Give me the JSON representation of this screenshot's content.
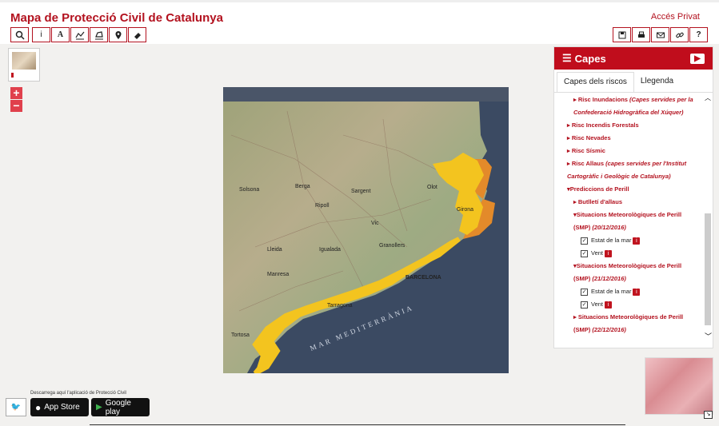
{
  "header": {
    "title": "Mapa de Protecció Civil de Catalunya",
    "login": "Accés Privat"
  },
  "toolbar_left": [
    "search-icon",
    "info-icon",
    "text-icon",
    "profile-icon",
    "area-icon",
    "marker-icon",
    "eraser-icon"
  ],
  "toolbar_left_labels": {
    "info": "i",
    "text": "A"
  },
  "toolbar_right": [
    "save-icon",
    "print-icon",
    "mail-icon",
    "link-icon",
    "help-icon"
  ],
  "toolbar_right_labels": {
    "help": "?"
  },
  "zoom": {
    "in": "+",
    "out": "−"
  },
  "panel": {
    "title": "Capes",
    "tabs": [
      "Capes dels riscos",
      "Llegenda"
    ],
    "items": [
      {
        "prefix": "Risc Inundacions ",
        "italic": "(Capes servides per la"
      },
      {
        "italic": "Confederació Hidrogràfica del Xúquer)"
      },
      {
        "text": "Risc Incendis Forestals"
      },
      {
        "text": "Risc Nevades"
      },
      {
        "text": "Risc Sísmic"
      },
      {
        "prefix": "Risc Allaus ",
        "italic": "(capes servides per l'Institut"
      },
      {
        "italic": "Cartogràfic i Geològic de Catalunya)"
      },
      {
        "text": "Prediccions de Perill"
      },
      {
        "text": "Butlletí d'allaus"
      },
      {
        "text": "Situacions Meteorològiques de Perill"
      },
      {
        "prefix": "(SMP) ",
        "italic": "(20/12/2016)"
      },
      {
        "text": "Situacions Meteorològiques de Perill"
      },
      {
        "prefix": "(SMP) ",
        "italic": "(21/12/2016)"
      },
      {
        "text": "Situacions Meteorològiques de Perill"
      },
      {
        "prefix": "(SMP) ",
        "italic": "(22/12/2016)"
      }
    ],
    "checks": {
      "estat": "Estat de la mar",
      "vent": "Vent"
    }
  },
  "map": {
    "labels": [
      "Sargent",
      "Olot",
      "Berga",
      "Ripoll",
      "Solsona",
      "Manresa",
      "Igualada",
      "Granollers",
      "BARCELONA",
      "Lleida",
      "Tarragona",
      "Tortosa",
      "Vic",
      "Girona"
    ],
    "sea_label": "MAR MEDITERRÀNIA"
  },
  "footer": {
    "download_text": "Descarrega aquí l'aplicació de Protecció Civil",
    "appstore": "App Store",
    "googleplay": "Google play",
    "twitter": "twitter-icon"
  },
  "colors": {
    "accent": "#c00d1c",
    "yellow_warning": "#f3c220",
    "orange_warning": "#e6892a"
  }
}
